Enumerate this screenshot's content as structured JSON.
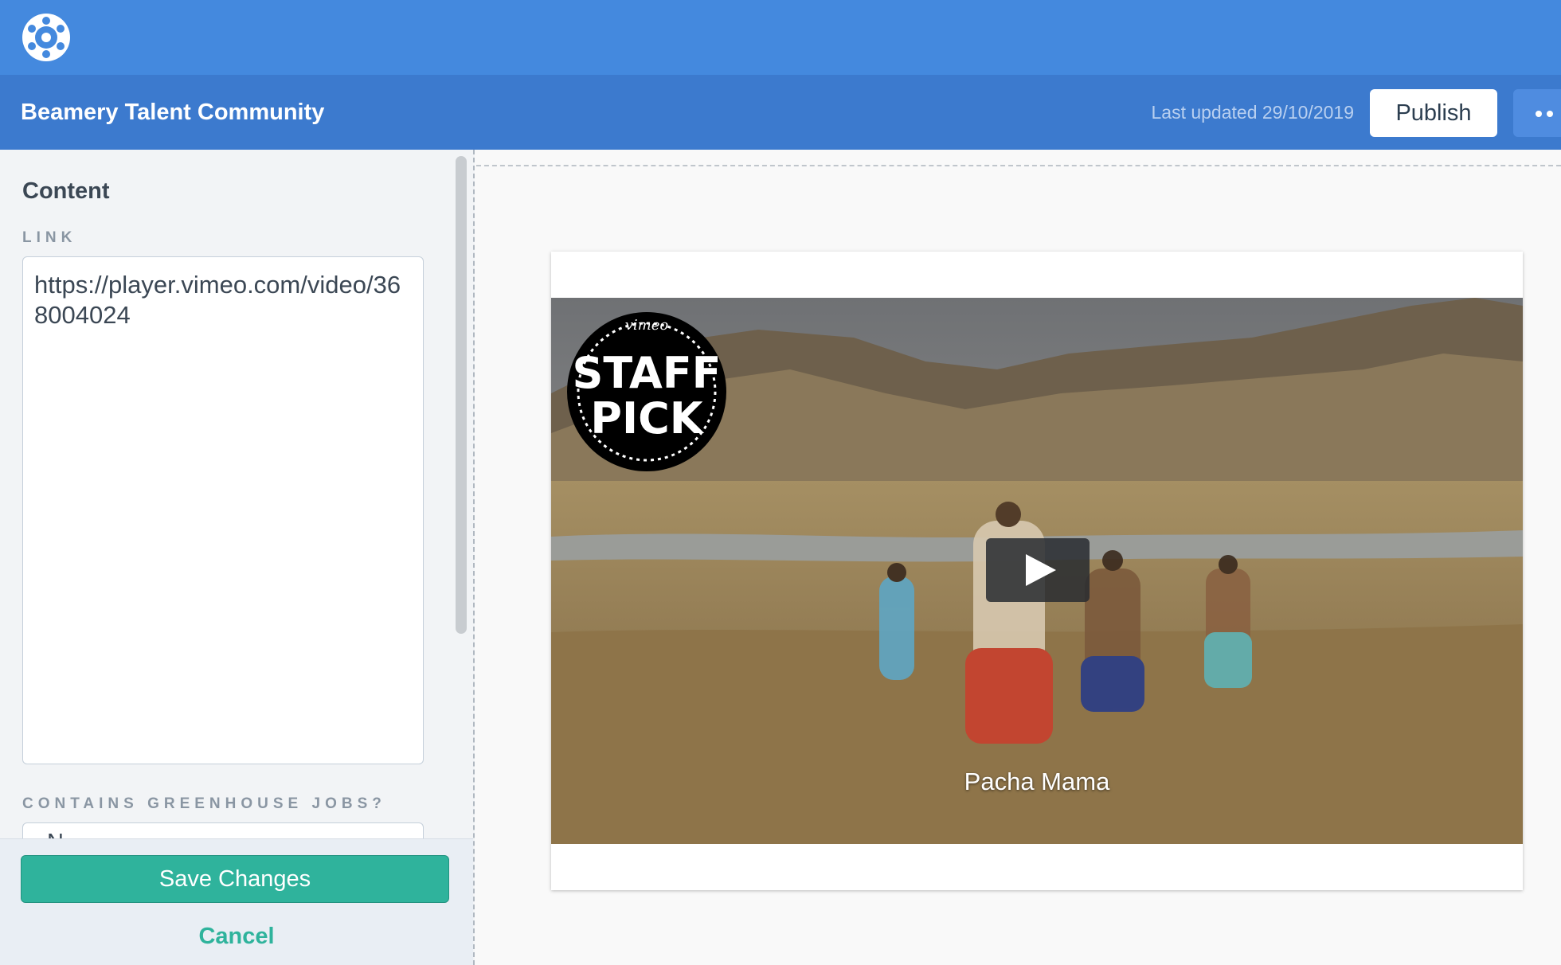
{
  "header": {
    "logo_icon": "beamery-logo-icon",
    "app_title": "Beamery Talent Community",
    "last_updated": "Last updated 29/10/2019",
    "publish_label": "Publish",
    "more_icon": "more-dots-icon"
  },
  "sidebar": {
    "section_title": "Content",
    "link_label": "LINK",
    "link_value": "https://player.vimeo.com/video/368004024",
    "greenhouse_label": "CONTAINS GREENHOUSE JOBS?",
    "greenhouse_value": "N",
    "save_label": "Save Changes",
    "cancel_label": "Cancel"
  },
  "preview": {
    "badge_brand": "vimeo",
    "badge_line1": "STAFF",
    "badge_line2": "PICK",
    "video_title": "Pacha Mama",
    "play_icon": "play-icon"
  },
  "colors": {
    "topbar": "#4489de",
    "subbar": "#3c7ace",
    "accent": "#2fb39c"
  }
}
